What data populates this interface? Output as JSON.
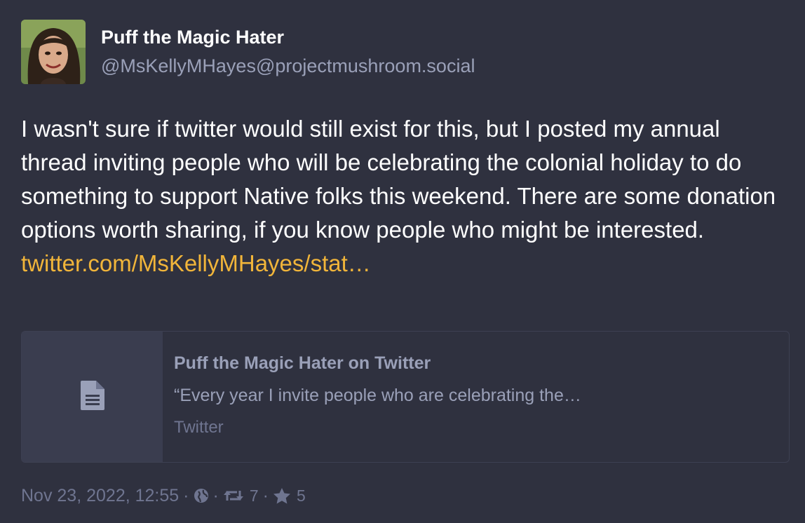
{
  "post": {
    "display_name": "Puff the Magic Hater",
    "handle": "@MsKellyMHayes@projectmushroom.social",
    "content_text": "I wasn't sure if twitter would still exist for this, but I posted my annual thread inviting people who will be celebrating the colonial holiday to do something to support Native folks this weekend. There are some donation options worth sharing, if you know people who might be interested.",
    "link_text": "twitter.com/MsKellyMHayes/stat…"
  },
  "card": {
    "title": "Puff the Magic Hater on Twitter",
    "description": "“Every year I invite people who are celebrating the…",
    "provider": "Twitter",
    "thumb_icon": "document-icon"
  },
  "meta": {
    "timestamp": "Nov 23, 2022, 12:55",
    "separator": "·",
    "visibility_icon": "globe-icon",
    "boost_icon": "retweet-icon",
    "boost_count": "7",
    "favourite_icon": "star-icon",
    "favourite_count": "5"
  },
  "colors": {
    "background": "#2f313f",
    "link": "#f1b53a",
    "muted": "#9aa0b8",
    "dim": "#6f7590"
  }
}
